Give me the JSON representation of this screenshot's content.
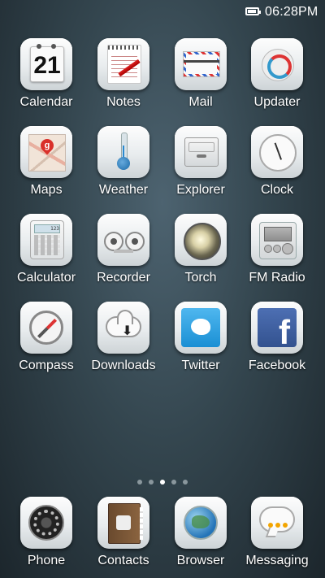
{
  "status_bar": {
    "battery_icon": "battery-full-icon",
    "time": "06:28PM"
  },
  "apps": [
    {
      "label": "Calendar",
      "icon": "calendar-icon",
      "day": "21"
    },
    {
      "label": "Notes",
      "icon": "notepad-icon"
    },
    {
      "label": "Mail",
      "icon": "envelope-icon"
    },
    {
      "label": "Updater",
      "icon": "refresh-icon"
    },
    {
      "label": "Maps",
      "icon": "map-pin-icon",
      "badge": "g"
    },
    {
      "label": "Weather",
      "icon": "thermometer-icon"
    },
    {
      "label": "Explorer",
      "icon": "file-drawer-icon"
    },
    {
      "label": "Clock",
      "icon": "clock-icon"
    },
    {
      "label": "Calculator",
      "icon": "calculator-icon",
      "display": "123"
    },
    {
      "label": "Recorder",
      "icon": "tape-recorder-icon"
    },
    {
      "label": "Torch",
      "icon": "flashlight-icon"
    },
    {
      "label": "FM Radio",
      "icon": "radio-icon"
    },
    {
      "label": "Compass",
      "icon": "compass-icon"
    },
    {
      "label": "Downloads",
      "icon": "cloud-download-icon"
    },
    {
      "label": "Twitter",
      "icon": "twitter-bird-icon"
    },
    {
      "label": "Facebook",
      "icon": "facebook-f-icon",
      "glyph": "f"
    }
  ],
  "pager": {
    "pages": 5,
    "current": 3
  },
  "dock": [
    {
      "label": "Phone",
      "icon": "rotary-phone-icon"
    },
    {
      "label": "Contacts",
      "icon": "address-book-icon"
    },
    {
      "label": "Browser",
      "icon": "globe-icon"
    },
    {
      "label": "Messaging",
      "icon": "chat-bubble-icon"
    }
  ],
  "colors": {
    "wallpaper": "#34464f",
    "label_text": "#ffffff",
    "twitter_blue": "#1a8fd4",
    "facebook_blue": "#3b5998",
    "message_dots": "#f3a500"
  }
}
